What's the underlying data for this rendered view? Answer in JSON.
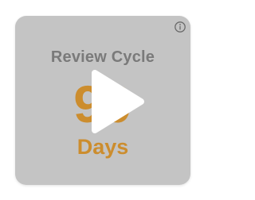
{
  "widget": {
    "title": "Review Cycle",
    "number": "90",
    "unit": "Days",
    "accent_color": "#cc8d2e",
    "title_color": "#7a7a7a",
    "background_color": "#c4c4c4"
  },
  "controls": {
    "info_icon": "info-icon",
    "play_icon": "play-icon"
  }
}
